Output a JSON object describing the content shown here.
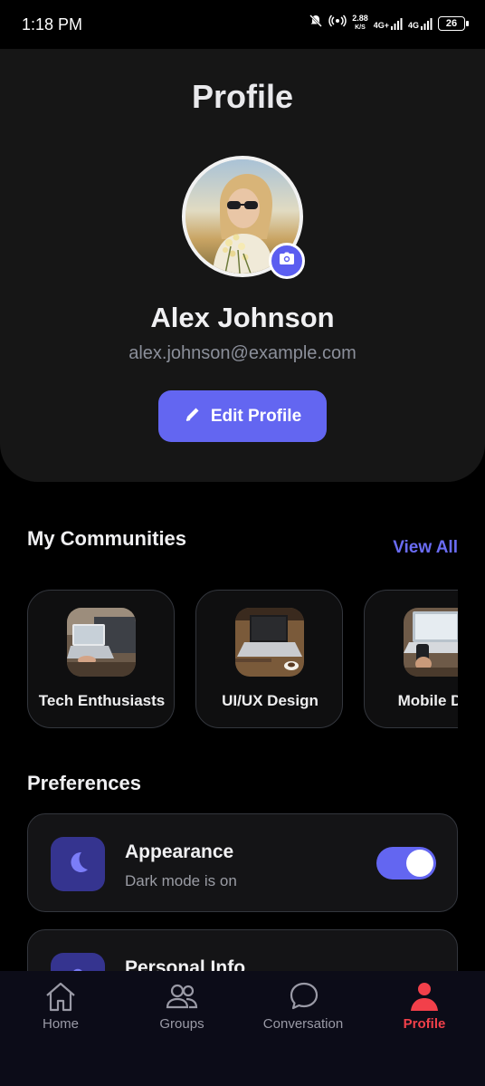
{
  "status_bar": {
    "time": "1:18 PM",
    "net_speed_value": "2.88",
    "net_speed_unit": "K/S",
    "network_1": "4G+",
    "network_2": "4G",
    "battery": "26"
  },
  "header": {
    "title": "Profile",
    "avatar_icon": "user-photo",
    "camera_icon": "camera-icon",
    "name": "Alex Johnson",
    "email": "alex.johnson@example.com",
    "edit_button_label": "Edit Profile",
    "edit_icon": "pencil-icon"
  },
  "communities": {
    "title": "My Communities",
    "view_all_label": "View All",
    "items": [
      {
        "label": "Tech Enthusiasts"
      },
      {
        "label": "UI/UX Design"
      },
      {
        "label": "Mobile Dev"
      }
    ]
  },
  "preferences": {
    "title": "Preferences",
    "items": [
      {
        "title": "Appearance",
        "subtitle": "Dark mode is on",
        "icon": "moon-icon",
        "toggle_on": true
      },
      {
        "title": "Personal Info",
        "icon": "user-icon"
      }
    ]
  },
  "bottom_nav": {
    "items": [
      {
        "label": "Home",
        "icon": "home-icon"
      },
      {
        "label": "Groups",
        "icon": "groups-icon"
      },
      {
        "label": "Conversation",
        "icon": "chat-icon"
      },
      {
        "label": "Profile",
        "icon": "profile-icon",
        "active": true
      }
    ]
  },
  "colors": {
    "accent": "#6366f1",
    "active_tab": "#f2404a",
    "card": "#161616",
    "background": "#000000"
  }
}
